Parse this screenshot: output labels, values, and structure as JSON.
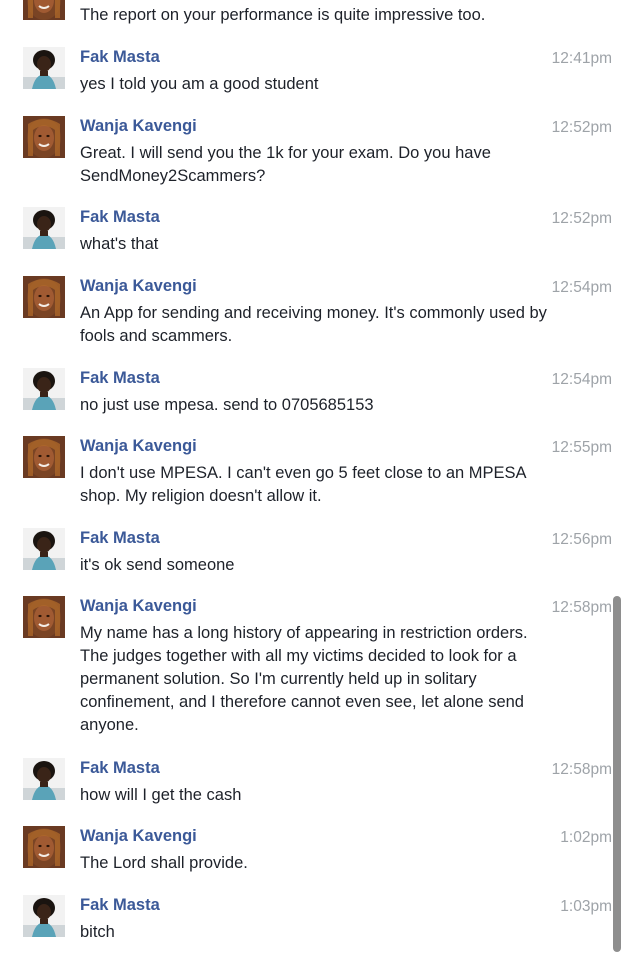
{
  "messages": [
    {
      "sender": "",
      "avatar": "wanja-avatar",
      "time": "",
      "text": "The report on your performance is quite impressive too."
    },
    {
      "sender": "Fak Masta",
      "avatar": "fak-avatar",
      "time": "12:41pm",
      "text": "yes I told you am a good student"
    },
    {
      "sender": "Wanja Kavengi",
      "avatar": "wanja-avatar",
      "time": "12:52pm",
      "text": "Great. I will send you the 1k for your exam. Do you have SendMoney2Scammers?"
    },
    {
      "sender": "Fak Masta",
      "avatar": "fak-avatar",
      "time": "12:52pm",
      "text": "what's that"
    },
    {
      "sender": "Wanja Kavengi",
      "avatar": "wanja-avatar",
      "time": "12:54pm",
      "text": "An App for sending and receiving money. It's commonly used by fools and scammers."
    },
    {
      "sender": "Fak Masta",
      "avatar": "fak-avatar",
      "time": "12:54pm",
      "text": "no just use mpesa. send to 0705685153"
    },
    {
      "sender": "Wanja Kavengi",
      "avatar": "wanja-avatar",
      "time": "12:55pm",
      "text": "I don't use MPESA. I can't even go 5 feet close to an MPESA shop. My religion doesn't allow it."
    },
    {
      "sender": "Fak Masta",
      "avatar": "fak-avatar",
      "time": "12:56pm",
      "text": "it's ok send someone"
    },
    {
      "sender": "Wanja Kavengi",
      "avatar": "wanja-avatar",
      "time": "12:58pm",
      "text": "My name has a long history of appearing in restriction orders. The judges together with all my victims decided to look for a permanent solution. So I'm currently held up in solitary confinement, and I therefore cannot even see, let alone send anyone."
    },
    {
      "sender": "Fak Masta",
      "avatar": "fak-avatar",
      "time": "12:58pm",
      "text": "how will I get the cash"
    },
    {
      "sender": "Wanja Kavengi",
      "avatar": "wanja-avatar",
      "time": "1:02pm",
      "text": "The Lord shall provide."
    },
    {
      "sender": "Fak Masta",
      "avatar": "fak-avatar",
      "time": "1:03pm",
      "text": "bitch"
    }
  ]
}
